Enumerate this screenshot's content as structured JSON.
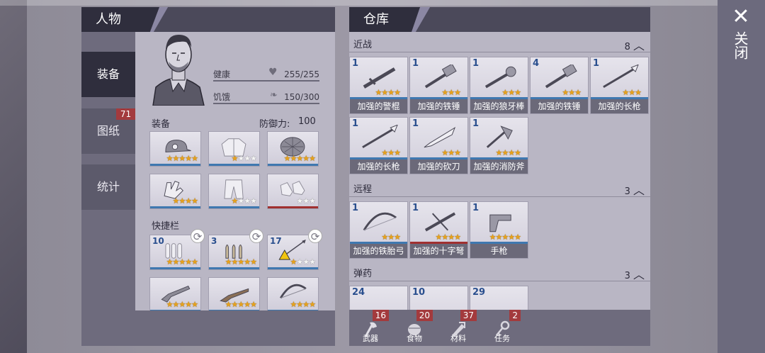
{
  "window": {
    "close_label": "关闭"
  },
  "character": {
    "title": "人物",
    "tabs": [
      {
        "label": "装备"
      },
      {
        "label": "图纸",
        "badge": "71"
      },
      {
        "label": "统计"
      }
    ],
    "health": {
      "label": "健康",
      "value": "255/255"
    },
    "hunger": {
      "label": "饥饿",
      "value": "150/300"
    },
    "equipment_label": "装备",
    "defense_label": "防御力:",
    "defense_value": "100",
    "quickbar_label": "快捷栏",
    "equipment": [
      {
        "icon": "helmet-icon",
        "stars": 5,
        "max": 5,
        "bar": "blue"
      },
      {
        "icon": "jacket-icon",
        "stars": 1,
        "max": 4,
        "bar": "blue"
      },
      {
        "icon": "shield-icon",
        "stars": 5,
        "max": 5,
        "bar": "blue"
      },
      {
        "icon": "gloves-icon",
        "stars": 4,
        "max": 4,
        "bar": "blue"
      },
      {
        "icon": "pants-icon",
        "stars": 1,
        "max": 4,
        "bar": "blue"
      },
      {
        "icon": "boots-icon",
        "stars": 0,
        "max": 3,
        "bar": "red"
      }
    ],
    "quickbar": [
      {
        "count": "10",
        "icon": "bullets-icon",
        "stars": 5,
        "max": 5
      },
      {
        "count": "3",
        "icon": "shells-icon",
        "stars": 5,
        "max": 5
      },
      {
        "count": "17",
        "icon": "arrow-icon",
        "stars": 1,
        "max": 4
      },
      {
        "icon": "shotgun-icon",
        "stars": 5,
        "max": 5
      },
      {
        "icon": "rifle-icon",
        "stars": 5,
        "max": 5
      },
      {
        "icon": "bow-icon",
        "stars": 4,
        "max": 4
      }
    ]
  },
  "warehouse": {
    "title": "仓库",
    "categories": [
      {
        "label": "近战",
        "count": "8",
        "items": [
          {
            "count": "1",
            "name": "加强的警棍",
            "stars": 4,
            "max": 4
          },
          {
            "count": "1",
            "name": "加强的铁锤",
            "stars": 3,
            "max": 3
          },
          {
            "count": "1",
            "name": "加强的狼牙棒",
            "stars": 3,
            "max": 3
          },
          {
            "count": "4",
            "name": "加强的铁锤",
            "stars": 3,
            "max": 3
          },
          {
            "count": "1",
            "name": "加强的长枪",
            "stars": 3,
            "max": 3
          },
          {
            "count": "1",
            "name": "加强的长枪",
            "stars": 3,
            "max": 3
          },
          {
            "count": "1",
            "name": "加强的砍刀",
            "stars": 3,
            "max": 3
          },
          {
            "count": "1",
            "name": "加强的消防斧",
            "stars": 4,
            "max": 4
          }
        ]
      },
      {
        "label": "远程",
        "count": "3",
        "items": [
          {
            "count": "1",
            "name": "加强的铁胎弓",
            "stars": 3,
            "max": 3
          },
          {
            "count": "1",
            "name": "加强的十字弩",
            "stars": 4,
            "max": 4
          },
          {
            "count": "1",
            "name": "手枪",
            "stars": 5,
            "max": 5
          }
        ]
      },
      {
        "label": "弹药",
        "count": "3",
        "items": [
          {
            "count": "24"
          },
          {
            "count": "10"
          },
          {
            "count": "29"
          }
        ]
      }
    ],
    "tabs": [
      {
        "label": "武器",
        "badge": "16"
      },
      {
        "label": "食物",
        "badge": "20"
      },
      {
        "label": "材料",
        "badge": "37"
      },
      {
        "label": "任务",
        "badge": "2"
      }
    ]
  }
}
